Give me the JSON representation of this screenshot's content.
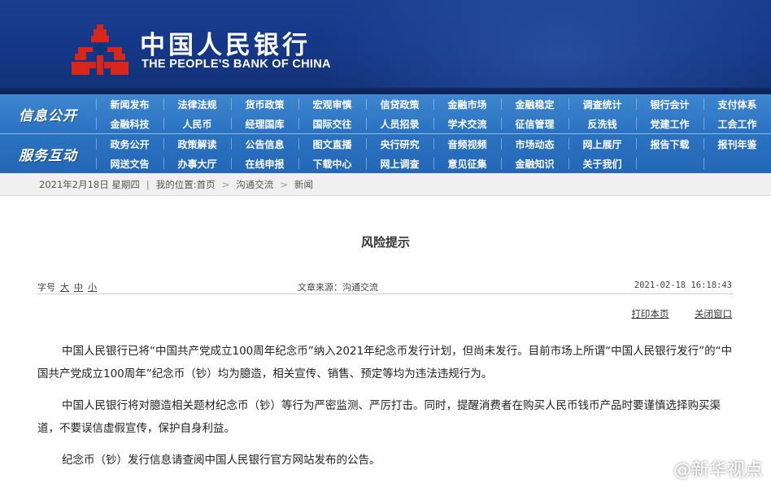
{
  "header": {
    "name_cn": "中国人民银行",
    "name_en": "THE PEOPLE'S BANK OF CHINA",
    "brand_red": "#d7261b"
  },
  "nav": {
    "sections": [
      {
        "label": "信息公开",
        "rows": [
          [
            "新闻发布",
            "法律法规",
            "货币政策",
            "宏观审慎",
            "信贷政策",
            "金融市场",
            "金融稳定",
            "调查统计",
            "银行会计",
            "支付体系"
          ],
          [
            "金融科技",
            "人民币",
            "经理国库",
            "国际交往",
            "人员招录",
            "学术交流",
            "征信管理",
            "反洗钱",
            "党建工作",
            "工会工作"
          ]
        ]
      },
      {
        "label": "服务互动",
        "rows": [
          [
            "政务公开",
            "政策解读",
            "公告信息",
            "图文直播",
            "央行研究",
            "音频视频",
            "市场动态",
            "网上展厅",
            "报告下载",
            "报刊年鉴"
          ],
          [
            "网送文告",
            "办事大厅",
            "在线申报",
            "下载中心",
            "网上调查",
            "意见征集",
            "金融知识",
            "关于我们",
            "",
            ""
          ]
        ]
      }
    ]
  },
  "breadcrumb": {
    "date": "2021年2月18日 星期四",
    "location_label": "我的位置:",
    "items": [
      "首页",
      "沟通交流",
      "新闻"
    ]
  },
  "article": {
    "title": "风险提示",
    "font_size_label": "字号",
    "font_sizes": [
      "大",
      "中",
      "小"
    ],
    "source": "文章来源：沟通交流",
    "datetime": "2021-02-18 16:18:43",
    "print_label": "打印本页",
    "close_label": "关闭窗口",
    "paragraphs": [
      "中国人民银行已将“中国共产党成立100周年纪念币”纳入2021年纪念币发行计划，但尚未发行。目前市场上所谓“中国人民银行发行”的“中国共产党成立100周年”纪念币（钞）均为臆造，相关宣传、销售、预定等均为违法违规行为。",
      "中国人民银行将对臆造相关题材纪念币（钞）等行为严密监测、严厉打击。同时，提醒消费者在购买人民币钱币产品时要谨慎选择购买渠道，不要误信虚假宣传，保护自身利益。",
      "纪念币（钞）发行信息请查阅中国人民银行官方网站发布的公告。"
    ]
  },
  "watermark": "@新华视点"
}
